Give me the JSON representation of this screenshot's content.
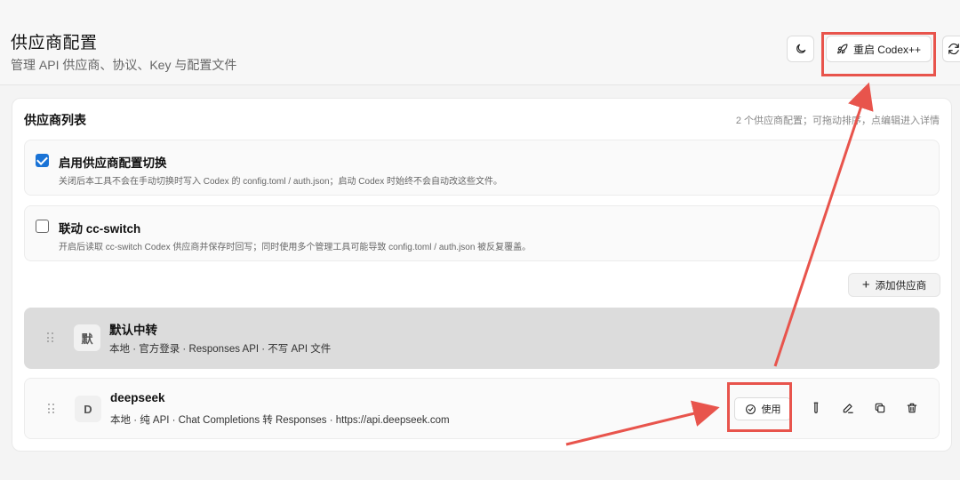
{
  "window": {
    "controls": [
      "minimize",
      "maximize",
      "close"
    ],
    "close_glyph": "✕"
  },
  "header": {
    "title": "供应商配置",
    "subtitle": "管理 API 供应商、协议、Key 与配置文件",
    "theme_icon": "moon-icon",
    "restart_label": "重启 Codex++",
    "restart_icon": "rocket-icon",
    "refresh_icon": "refresh-icon"
  },
  "panel": {
    "title": "供应商列表",
    "hint": "2 个供应商配置；可拖动排序，点编辑进入详情"
  },
  "options": [
    {
      "checked": true,
      "title": "启用供应商配置切换",
      "desc": "关闭后本工具不会在手动切换时写入 Codex 的 config.toml / auth.json；启动 Codex 时始终不会自动改这些文件。"
    },
    {
      "checked": false,
      "title": "联动 cc-switch",
      "desc": "开启后读取 cc-switch Codex 供应商并保存时回写；同时使用多个管理工具可能导致 config.toml / auth.json 被反复覆盖。"
    }
  ],
  "add_button": {
    "label": "添加供应商",
    "plus": "+"
  },
  "providers": [
    {
      "avatar": "默",
      "name": "默认中转",
      "desc": "本地 · 官方登录 · Responses API · 不写 API 文件",
      "active": true
    },
    {
      "avatar": "D",
      "name": "deepseek",
      "desc": "本地 · 纯 API · Chat Completions 转 Responses · https://api.deepseek.com",
      "active": false,
      "use_label": "使用",
      "actions": [
        "test-icon",
        "edit-icon",
        "copy-icon",
        "delete-icon"
      ]
    }
  ],
  "annotations": {
    "color": "#e8544c"
  }
}
